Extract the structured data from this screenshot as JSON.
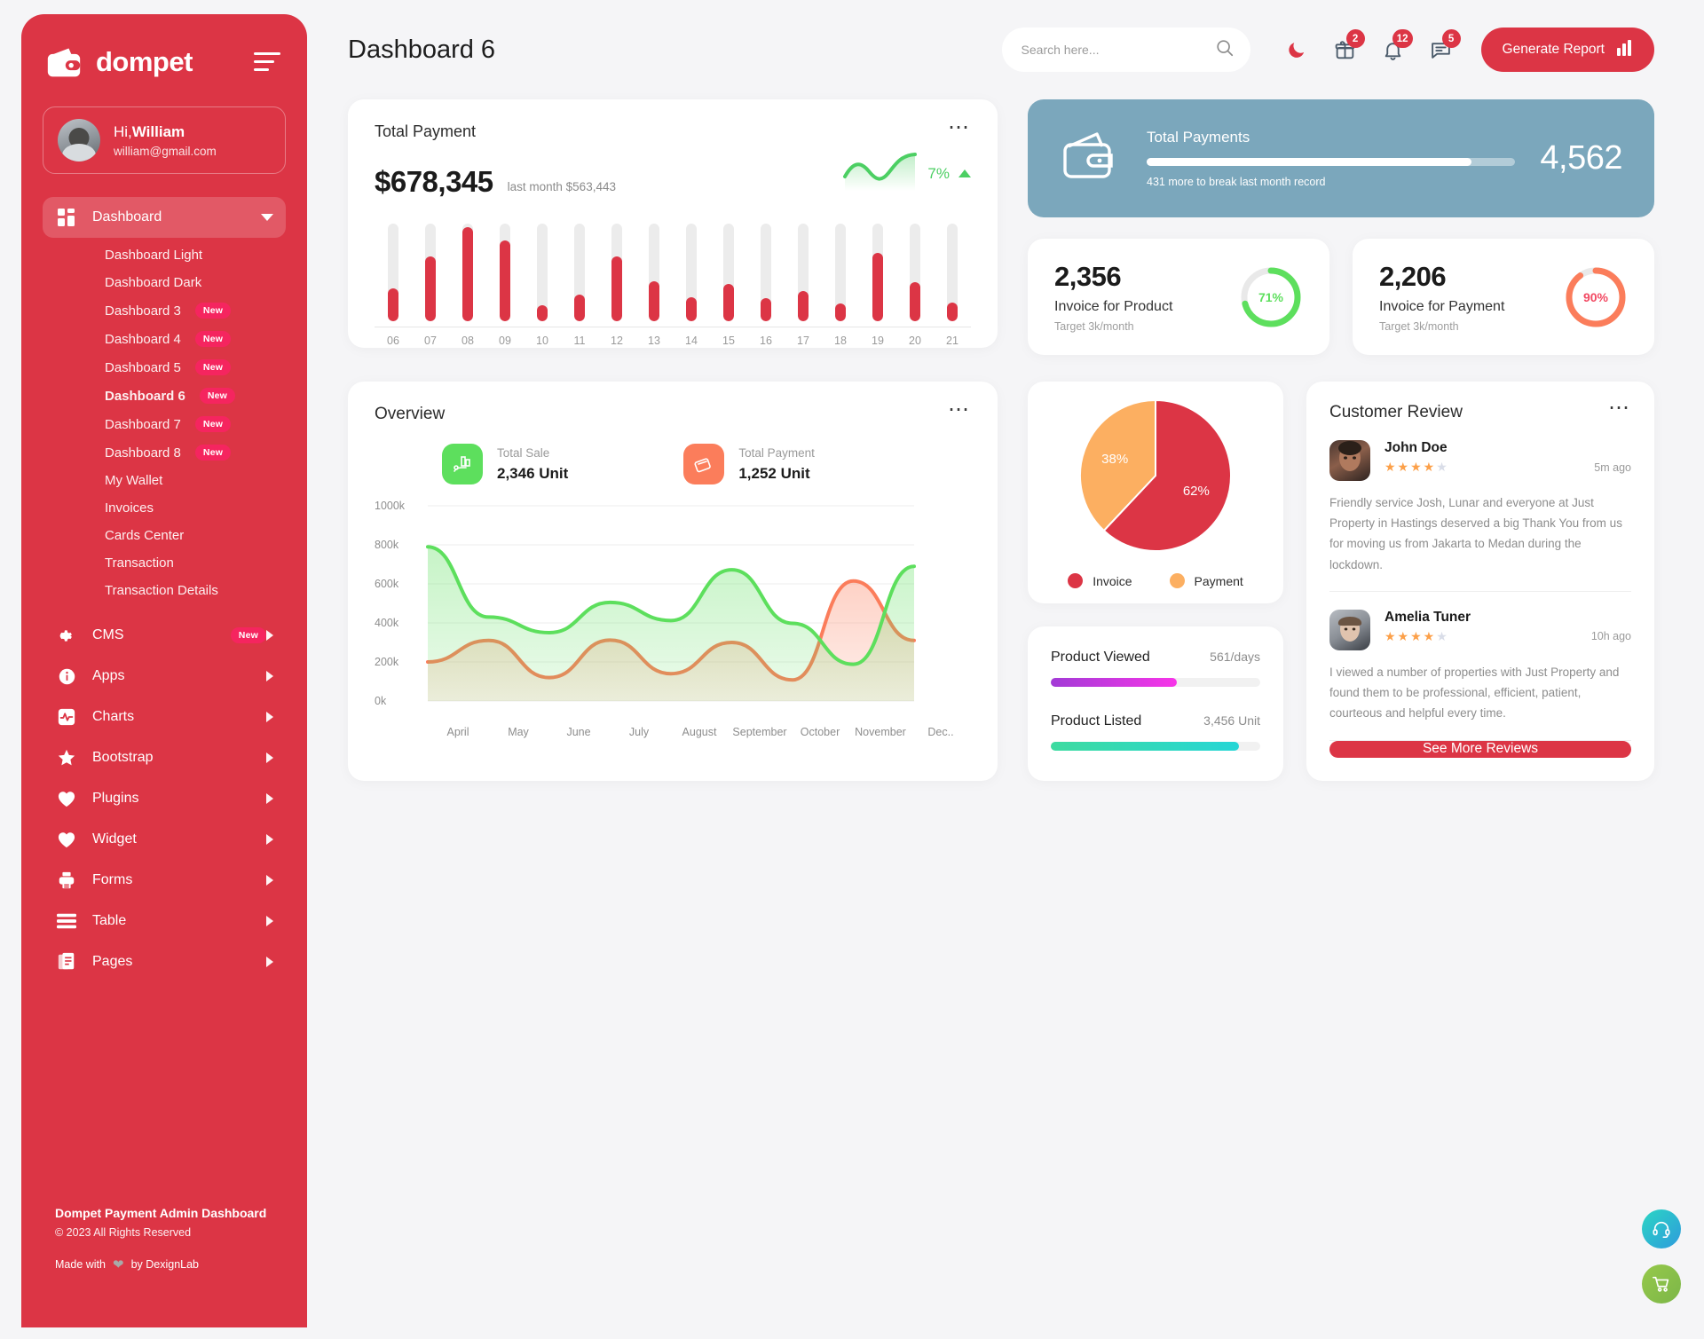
{
  "brand": {
    "name": "dompet",
    "logo_icon": "wallet-icon",
    "menu_icon": "hamburger-icon"
  },
  "profile": {
    "greeting_prefix": "Hi,",
    "name": "William",
    "email": "william@gmail.com"
  },
  "sidebar": {
    "dashboard": {
      "label": "Dashboard",
      "icon": "grid-icon"
    },
    "sub_items": [
      {
        "label": "Dashboard Light",
        "badge": ""
      },
      {
        "label": "Dashboard Dark",
        "badge": ""
      },
      {
        "label": "Dashboard 3",
        "badge": "New"
      },
      {
        "label": "Dashboard 4",
        "badge": "New"
      },
      {
        "label": "Dashboard 5",
        "badge": "New"
      },
      {
        "label": "Dashboard 6",
        "badge": "New"
      },
      {
        "label": "Dashboard 7",
        "badge": "New"
      },
      {
        "label": "Dashboard 8",
        "badge": "New"
      },
      {
        "label": "My Wallet",
        "badge": ""
      },
      {
        "label": "Invoices",
        "badge": ""
      },
      {
        "label": "Cards Center",
        "badge": ""
      },
      {
        "label": "Transaction",
        "badge": ""
      },
      {
        "label": "Transaction Details",
        "badge": ""
      }
    ],
    "menu": [
      {
        "label": "CMS",
        "icon": "gear-icon",
        "badge": "New"
      },
      {
        "label": "Apps",
        "icon": "info-icon",
        "badge": ""
      },
      {
        "label": "Charts",
        "icon": "pulse-icon",
        "badge": ""
      },
      {
        "label": "Bootstrap",
        "icon": "star-icon",
        "badge": ""
      },
      {
        "label": "Plugins",
        "icon": "heart-icon",
        "badge": ""
      },
      {
        "label": "Widget",
        "icon": "heart-icon",
        "badge": ""
      },
      {
        "label": "Forms",
        "icon": "printer-icon",
        "badge": ""
      },
      {
        "label": "Table",
        "icon": "list-icon",
        "badge": ""
      },
      {
        "label": "Pages",
        "icon": "pages-icon",
        "badge": ""
      }
    ],
    "footer": {
      "title": "Dompet Payment Admin Dashboard",
      "copyright": "© 2023 All Rights Reserved",
      "made_prefix": "Made with",
      "made_suffix": "by DexignLab",
      "heart_icon": "heart-icon"
    }
  },
  "header": {
    "page_title": "Dashboard 6",
    "search": {
      "placeholder": "Search here...",
      "value": "",
      "icon": "search-icon"
    },
    "theme_toggle_icon": "moon-icon",
    "icons": [
      {
        "name": "gift-icon",
        "badge": "2"
      },
      {
        "name": "bell-icon",
        "badge": "12"
      },
      {
        "name": "message-icon",
        "badge": "5"
      }
    ],
    "generate_report": {
      "label": "Generate Report",
      "icon": "bar-chart-icon"
    }
  },
  "total_payment": {
    "title": "Total Payment",
    "amount": "$678,345",
    "last_month": "last month $563,443",
    "percent": "7%",
    "trend": "up",
    "menu_icon": "more-icon"
  },
  "total_payments_banner": {
    "label": "Total Payments",
    "value": "4,562",
    "sub": "431 more to break last month record",
    "progress": 88,
    "icon": "wallet-icon",
    "bg_color": "#7ba7bc"
  },
  "stats": [
    {
      "number": "2,356",
      "label": "Invoice for Product",
      "sub": "Target 3k/month",
      "percent": "71%",
      "percent_value": 71,
      "color": "#5ddf5d"
    },
    {
      "number": "2,206",
      "label": "Invoice for Payment",
      "sub": "Target 3k/month",
      "percent": "90%",
      "percent_value": 90,
      "color": "#fb7d5b"
    }
  ],
  "overview": {
    "title": "Overview",
    "menu_icon": "more-icon",
    "stats": [
      {
        "label": "Total Sale",
        "value": "2,346 Unit",
        "icon": "sale-hand-icon",
        "color": "#5ddf5d"
      },
      {
        "label": "Total Payment",
        "value": "1,252 Unit",
        "icon": "card-terminal-icon",
        "color": "#fb7d5b"
      }
    ]
  },
  "customer_review": {
    "title": "Customer Review",
    "menu_icon": "more-icon",
    "reviews": [
      {
        "name": "John Doe",
        "stars": 4,
        "max_stars": 5,
        "ago": "5m ago",
        "text": "Friendly service Josh, Lunar and everyone at Just Property in Hastings deserved a big Thank You from us for moving us from Jakarta to Medan during the lockdown."
      },
      {
        "name": "Amelia Tuner",
        "stars": 4,
        "max_stars": 5,
        "ago": "10h ago",
        "text": "I viewed a number of properties with Just Property and found them to be professional, efficient, patient, courteous and helpful every time."
      }
    ],
    "see_more": "See More Reviews"
  },
  "progress_card": {
    "items": [
      {
        "label": "Product Viewed",
        "value": "561/days",
        "percent": 60,
        "color_start": "#a23bd6",
        "color_end": "#f735e8"
      },
      {
        "label": "Product Listed",
        "value": "3,456 Unit",
        "percent": 90,
        "color_start": "#3ddba0",
        "color_end": "#26d6d6"
      }
    ]
  },
  "fabs": [
    {
      "name": "support-headset-icon"
    },
    {
      "name": "shopping-cart-icon"
    }
  ],
  "chart_data": [
    {
      "type": "bar",
      "title": "Total Payment",
      "categories": [
        "06",
        "07",
        "08",
        "09",
        "10",
        "11",
        "12",
        "13",
        "14",
        "15",
        "16",
        "17",
        "18",
        "19",
        "20",
        "21"
      ],
      "values": [
        34,
        66,
        96,
        83,
        16,
        27,
        66,
        41,
        25,
        38,
        24,
        31,
        18,
        70,
        40,
        19
      ],
      "ylim": [
        0,
        100
      ],
      "xlabel": "",
      "ylabel": "",
      "grid": false,
      "track_color": "#ececec",
      "bar_color": "#dc3545"
    },
    {
      "type": "area",
      "title": "Overview",
      "categories": [
        "April",
        "May",
        "June",
        "July",
        "August",
        "September",
        "October",
        "November",
        "Dec.."
      ],
      "series": [
        {
          "name": "Total Sale",
          "color": "#5ddf5d",
          "values": [
            790,
            430,
            350,
            505,
            412,
            672,
            398,
            188,
            690
          ]
        },
        {
          "name": "Total Payment",
          "color": "#fb7d5b",
          "values": [
            200,
            310,
            120,
            312,
            140,
            300,
            108,
            615,
            310
          ]
        }
      ],
      "ylim": [
        0,
        1000
      ],
      "yticks": [
        "0k",
        "200k",
        "400k",
        "600k",
        "800k",
        "1000k"
      ],
      "xlabel": "",
      "ylabel": "",
      "grid": true
    },
    {
      "type": "pie",
      "title": "",
      "labels": [
        "Invoice",
        "Payment"
      ],
      "values": [
        62,
        38
      ],
      "value_labels": [
        "62%",
        "38%"
      ],
      "colors": [
        "#dc3545",
        "#fcaf61"
      ],
      "legend": "bottom"
    },
    {
      "type": "donut",
      "title": "Invoice for Product",
      "labels": [
        "Achieved",
        "Remaining"
      ],
      "values": [
        71,
        29
      ],
      "value_labels": [
        "71%"
      ],
      "colors": [
        "#5ddf5d",
        "#e9e9e9"
      ]
    },
    {
      "type": "donut",
      "title": "Invoice for Payment",
      "labels": [
        "Achieved",
        "Remaining"
      ],
      "values": [
        90,
        10
      ],
      "value_labels": [
        "90%"
      ],
      "colors": [
        "#fb7d5b",
        "#e9e9e9"
      ]
    }
  ]
}
